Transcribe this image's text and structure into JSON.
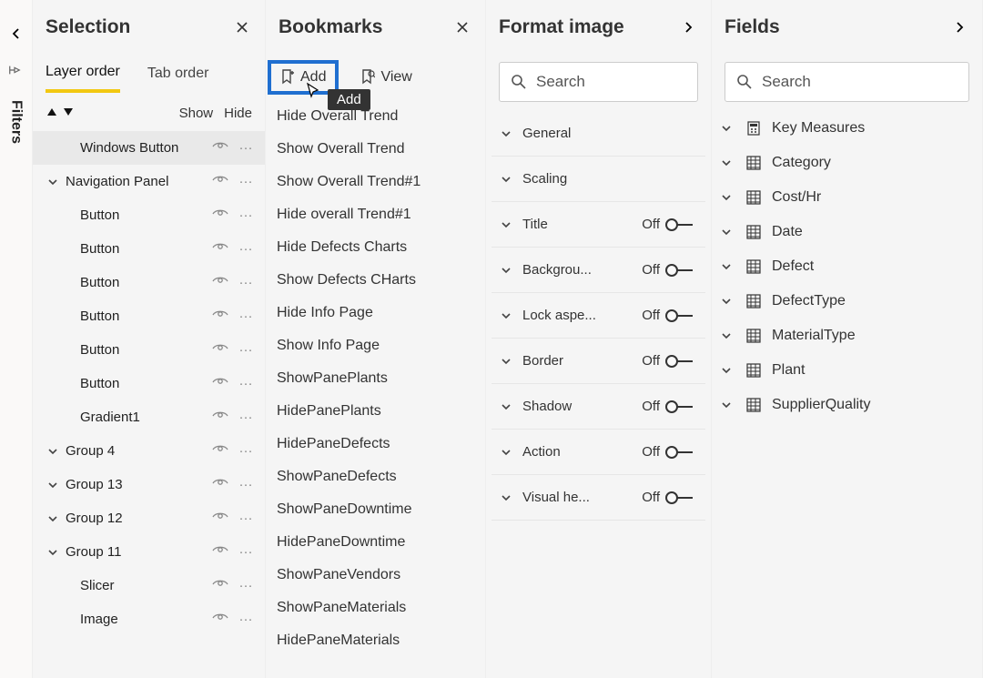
{
  "rail": {
    "filters_label": "Filters"
  },
  "selection": {
    "title": "Selection",
    "tabs": {
      "layer": "Layer order",
      "tab": "Tab order"
    },
    "subheader": {
      "show": "Show",
      "hide": "Hide"
    },
    "items": [
      {
        "label": "Windows Button",
        "selected": true,
        "indent": 0,
        "expander": "none"
      },
      {
        "label": "Navigation Panel",
        "selected": false,
        "indent": 0,
        "expander": "down"
      },
      {
        "label": "Button",
        "selected": false,
        "indent": 0,
        "expander": "none"
      },
      {
        "label": "Button",
        "selected": false,
        "indent": 0,
        "expander": "none"
      },
      {
        "label": "Button",
        "selected": false,
        "indent": 0,
        "expander": "none"
      },
      {
        "label": "Button",
        "selected": false,
        "indent": 0,
        "expander": "none"
      },
      {
        "label": "Button",
        "selected": false,
        "indent": 0,
        "expander": "none"
      },
      {
        "label": "Button",
        "selected": false,
        "indent": 0,
        "expander": "none"
      },
      {
        "label": "Gradient1",
        "selected": false,
        "indent": 0,
        "expander": "none"
      },
      {
        "label": "Group 4",
        "selected": false,
        "indent": 0,
        "expander": "down"
      },
      {
        "label": "Group 13",
        "selected": false,
        "indent": 0,
        "expander": "down"
      },
      {
        "label": "Group 12",
        "selected": false,
        "indent": 0,
        "expander": "down"
      },
      {
        "label": "Group 11",
        "selected": false,
        "indent": 0,
        "expander": "down"
      },
      {
        "label": "Slicer",
        "selected": false,
        "indent": 0,
        "expander": "none"
      },
      {
        "label": "Image",
        "selected": false,
        "indent": 0,
        "expander": "none"
      }
    ]
  },
  "bookmarks": {
    "title": "Bookmarks",
    "add_label": "Add",
    "view_label": "View",
    "tooltip": "Add",
    "items": [
      "Hide Overall Trend",
      "Show Overall Trend",
      "Show Overall Trend#1",
      "Hide overall Trend#1",
      "Hide Defects Charts",
      "Show Defects CHarts",
      "Hide Info Page",
      "Show Info Page",
      "ShowPanePlants",
      "HidePanePlants",
      "HidePaneDefects",
      "ShowPaneDefects",
      "ShowPaneDowntime",
      "HidePaneDowntime",
      "ShowPaneVendors",
      "ShowPaneMaterials",
      "HidePaneMaterials"
    ]
  },
  "format": {
    "title": "Format image",
    "search_placeholder": "Search",
    "off_label": "Off",
    "rows": [
      {
        "label": "General",
        "hasToggle": false
      },
      {
        "label": "Scaling",
        "hasToggle": false
      },
      {
        "label": "Title",
        "hasToggle": true
      },
      {
        "label": "Backgrou...",
        "hasToggle": true
      },
      {
        "label": "Lock aspe...",
        "hasToggle": true
      },
      {
        "label": "Border",
        "hasToggle": true
      },
      {
        "label": "Shadow",
        "hasToggle": true
      },
      {
        "label": "Action",
        "hasToggle": true
      },
      {
        "label": "Visual he...",
        "hasToggle": true
      }
    ]
  },
  "fields": {
    "title": "Fields",
    "search_placeholder": "Search",
    "items": [
      {
        "label": "Key Measures",
        "icon": "measure"
      },
      {
        "label": "Category",
        "icon": "table"
      },
      {
        "label": "Cost/Hr",
        "icon": "table"
      },
      {
        "label": "Date",
        "icon": "table"
      },
      {
        "label": "Defect",
        "icon": "table"
      },
      {
        "label": "DefectType",
        "icon": "table"
      },
      {
        "label": "MaterialType",
        "icon": "table"
      },
      {
        "label": "Plant",
        "icon": "table"
      },
      {
        "label": "SupplierQuality",
        "icon": "table"
      }
    ]
  }
}
